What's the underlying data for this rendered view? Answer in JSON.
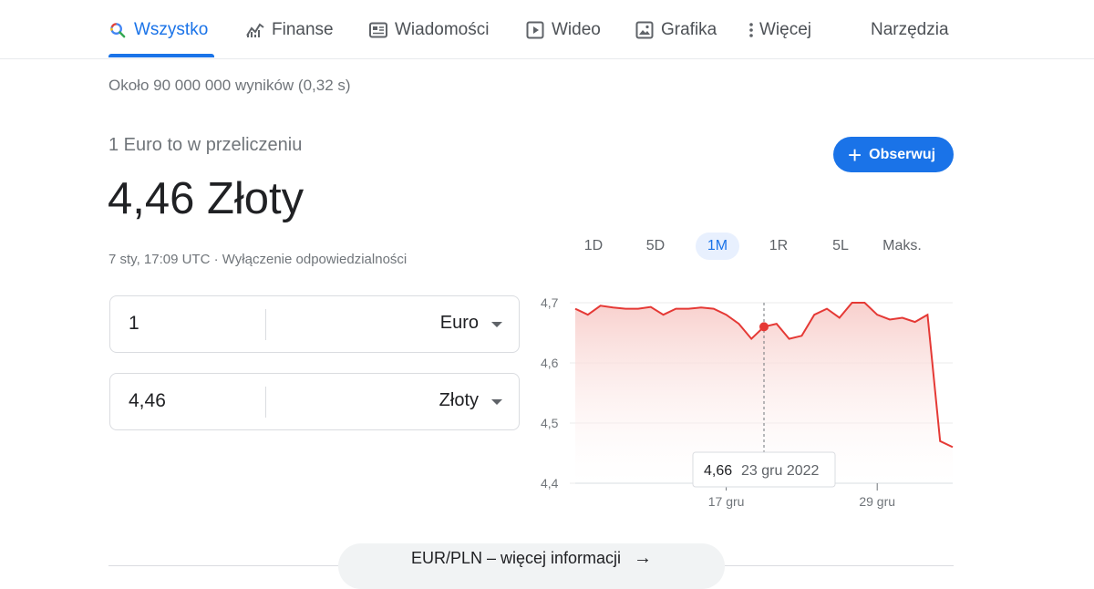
{
  "tabs": [
    {
      "label": "Wszystko",
      "icon": "search-icon",
      "active": true
    },
    {
      "label": "Finanse",
      "icon": "finance-chart-icon"
    },
    {
      "label": "Wiadomości",
      "icon": "news-icon"
    },
    {
      "label": "Wideo",
      "icon": "video-play-icon"
    },
    {
      "label": "Grafika",
      "icon": "image-icon"
    },
    {
      "label": "Więcej",
      "icon": "more-vertical-icon"
    }
  ],
  "tools_label": "Narzędzia",
  "result_stats": "Około 90 000 000 wyników (0,32 s)",
  "converter": {
    "label": "1 Euro to w przeliczeniu",
    "value": "4,46 Złoty",
    "timestamp": "7 sty, 17:09 UTC",
    "separator": " · ",
    "disclaimer": "Wyłączenie odpowiedzialności",
    "follow_label": "Obserwuj",
    "from_amount": "1",
    "from_currency": "Euro",
    "to_amount": "4,46",
    "to_currency": "Złoty"
  },
  "ranges": [
    "1D",
    "5D",
    "1M",
    "1R",
    "5L",
    "Maks."
  ],
  "selected_range": "1M",
  "colors": {
    "accent": "#1a73e8",
    "line": "#e53935",
    "fill": "#f8d0cd"
  },
  "chart_data": {
    "type": "area",
    "ylim": [
      4.4,
      4.7
    ],
    "yticks": [
      "4,7",
      "4,6",
      "4,5",
      "4,4"
    ],
    "ytick_values": [
      4.7,
      4.6,
      4.5,
      4.4
    ],
    "xticks": [
      {
        "label": "17 gru",
        "index": 12
      },
      {
        "label": "29 gru",
        "index": 24
      }
    ],
    "values": [
      4.69,
      4.68,
      4.695,
      4.692,
      4.69,
      4.69,
      4.693,
      4.68,
      4.69,
      4.69,
      4.692,
      4.69,
      4.68,
      4.665,
      4.64,
      4.66,
      4.665,
      4.64,
      4.645,
      4.68,
      4.69,
      4.675,
      4.7,
      4.7,
      4.68,
      4.672,
      4.675,
      4.668,
      4.68,
      4.47,
      4.46
    ],
    "highlight": {
      "index": 15,
      "value_label": "4,66",
      "date_label": "23 gru 2022"
    }
  },
  "more_info_label": "EUR/PLN – więcej informacji"
}
